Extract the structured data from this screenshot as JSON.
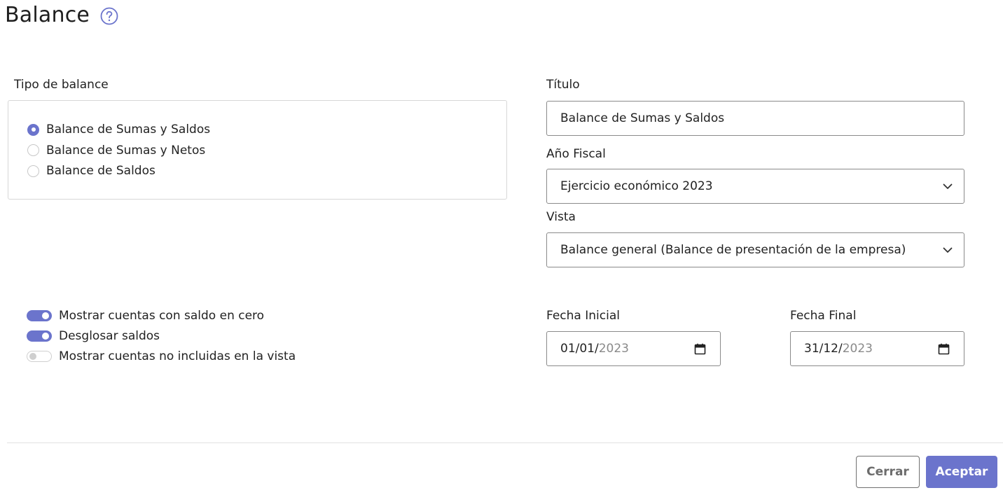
{
  "header": {
    "title": "Balance",
    "help_icon": "question-circle-icon"
  },
  "balance_type": {
    "label": "Tipo de balance",
    "options": [
      {
        "label": "Balance de Sumas y Saldos",
        "selected": true
      },
      {
        "label": "Balance de Sumas y Netos",
        "selected": false
      },
      {
        "label": "Balance de Saldos",
        "selected": false
      }
    ]
  },
  "titulo": {
    "label": "Título",
    "value": "Balance de Sumas y Saldos"
  },
  "fiscal_year": {
    "label": "Año Fiscal",
    "value": "Ejercicio económico 2023"
  },
  "vista": {
    "label": "Vista",
    "value": "Balance general (Balance de presentación de la empresa)"
  },
  "toggles": [
    {
      "label": "Mostrar cuentas con saldo en cero",
      "on": true
    },
    {
      "label": "Desglosar saldos",
      "on": true
    },
    {
      "label": "Mostrar cuentas no incluidas en la vista",
      "on": false
    }
  ],
  "start_date": {
    "label": "Fecha Inicial",
    "day_month": "01/01/",
    "year": "2023"
  },
  "end_date": {
    "label": "Fecha Final",
    "day_month": "31/12/",
    "year": "2023"
  },
  "footer": {
    "close_label": "Cerrar",
    "accept_label": "Aceptar"
  },
  "colors": {
    "accent": "#6b74cc",
    "border": "#8a8a8a",
    "panel_border": "#d7d7d7"
  }
}
